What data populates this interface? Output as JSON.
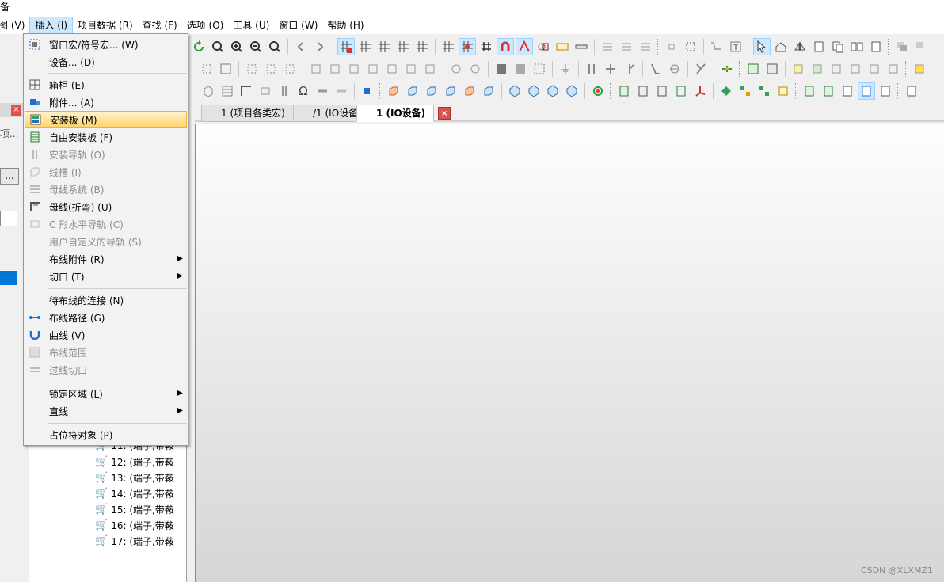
{
  "window": {
    "title_fragment": "备"
  },
  "menubar": {
    "items": [
      {
        "label": "图 (V)"
      },
      {
        "label": "插入 (I)"
      },
      {
        "label": "项目数据 (R)"
      },
      {
        "label": "查找 (F)"
      },
      {
        "label": "选项 (O)"
      },
      {
        "label": "工具 (U)"
      },
      {
        "label": "窗口 (W)"
      },
      {
        "label": "帮助 (H)"
      }
    ]
  },
  "insert_menu": {
    "items": [
      {
        "label": "窗口宏/符号宏... (W)",
        "icon": "macro-icon",
        "enabled": true
      },
      {
        "label": "设备... (D)",
        "icon": "",
        "enabled": true
      },
      {
        "label": "箱柜 (E)",
        "icon": "cabinet-icon",
        "enabled": true
      },
      {
        "label": "附件... (A)",
        "icon": "accessory-icon",
        "enabled": true
      },
      {
        "label": "安装板 (M)",
        "icon": "mounting-panel-icon",
        "enabled": true,
        "highlighted": true
      },
      {
        "label": "自由安装板 (F)",
        "icon": "free-panel-icon",
        "enabled": true
      },
      {
        "label": "安装导轨 (O)",
        "icon": "rail-icon",
        "enabled": false
      },
      {
        "label": "线槽 (I)",
        "icon": "cable-duct-icon",
        "enabled": false
      },
      {
        "label": "母线系统 (B)",
        "icon": "busbar-system-icon",
        "enabled": false
      },
      {
        "label": "母线(折弯) (U)",
        "icon": "busbar-bent-icon",
        "enabled": true
      },
      {
        "label": "C 形水平导轨 (C)",
        "icon": "c-rail-icon",
        "enabled": false
      },
      {
        "label": "用户自定义的导轨 (S)",
        "icon": "custom-rail-icon",
        "enabled": false
      },
      {
        "label": "布线附件 (R)",
        "icon": "",
        "enabled": true,
        "submenu": true
      },
      {
        "label": "切口 (T)",
        "icon": "",
        "enabled": true,
        "submenu": true
      },
      {
        "label": "待布线的连接 (N)",
        "icon": "",
        "enabled": true
      },
      {
        "label": "布线路径 (G)",
        "icon": "routing-path-icon",
        "enabled": true
      },
      {
        "label": "曲线 (V)",
        "icon": "curve-icon",
        "enabled": true
      },
      {
        "label": "布线范围 ",
        "icon": "routing-range-icon",
        "enabled": false
      },
      {
        "label": "过线切口",
        "icon": "cable-cutout-icon",
        "enabled": false
      },
      {
        "label": "锁定区域 (L)",
        "icon": "",
        "enabled": true,
        "submenu": true
      },
      {
        "label": "直线",
        "icon": "",
        "enabled": true,
        "submenu": true
      },
      {
        "label": "占位符对象 (P)",
        "icon": "",
        "enabled": true
      }
    ]
  },
  "left_panel": {
    "fragment1": "项...",
    "button": "..."
  },
  "tree": {
    "items": [
      {
        "label": "11: (端子,带鞍"
      },
      {
        "label": "12: (端子,带鞍"
      },
      {
        "label": "13: (端子,带鞍"
      },
      {
        "label": "14: (端子,带鞍"
      },
      {
        "label": "15: (端子,带鞍"
      },
      {
        "label": "16: (端子,带鞍"
      },
      {
        "label": "17: (端子,带鞍"
      }
    ]
  },
  "tabs": [
    {
      "label": "1 (项目各类宏)"
    },
    {
      "label": "/1 (IO设备)"
    },
    {
      "label": "1 (IO设备)",
      "active": true
    }
  ],
  "watermark": "CSDN @XLXMZ1"
}
